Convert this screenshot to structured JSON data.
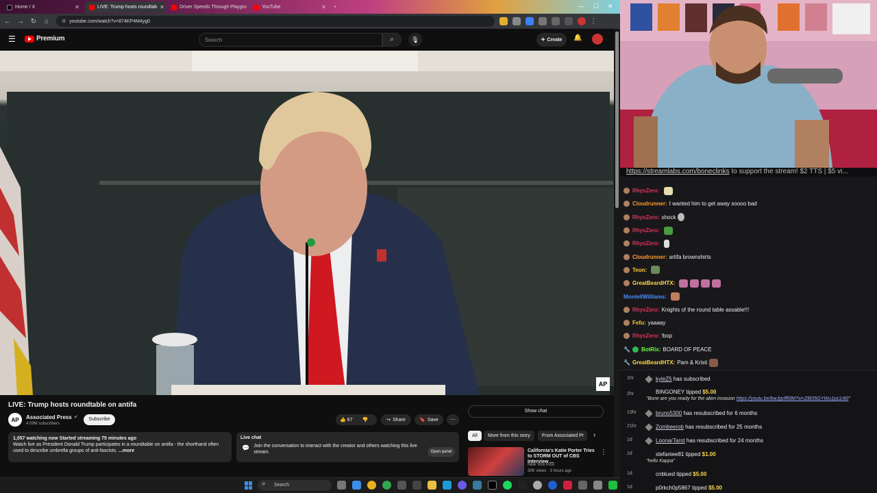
{
  "browser": {
    "tabs": [
      {
        "label": "Home / X",
        "color": "#000000"
      },
      {
        "label": "LIVE: Trump hosts roundtab",
        "color": "#ff0000"
      },
      {
        "label": "Driver Speeds Through Playgro",
        "color": "#ff0000"
      },
      {
        "label": "YouTube",
        "color": "#ff0000"
      }
    ],
    "url": "youtube.com/watch?v=874KP4M4yg0"
  },
  "youtube": {
    "brand": "Premium",
    "search_placeholder": "Search",
    "create_label": "Create",
    "video_title": "LIVE: Trump hosts roundtable on antifa",
    "channel_name": "Associated Press",
    "channel_avatar_text": "AP",
    "subscribers": "4.09M subscribers",
    "subscribe_label": "Subscribe",
    "likes": "67",
    "share_label": "Share",
    "save_label": "Save",
    "show_chat_label": "Show chat",
    "description_stats": "1,057 watching now  Started streaming 75 minutes ago",
    "description_text": "Watch live as President Donald Trump participates in a roundtable on antifa - the shorthand often used to describe umbrella groups of anti-fascists.",
    "more_label": "...more",
    "live_chat_title": "Live chat",
    "live_chat_text": "Join the conversation to interact with the creator and others watching this live stream.",
    "open_panel_label": "Open panel",
    "chips": [
      "All",
      "More from this story",
      "From Associated Pr"
    ],
    "rec": {
      "title": "California's Katie Porter Tries to STORM OUT of CBS Interview ...",
      "channel": "New York Post",
      "meta": "30K views · 3 hours ago"
    },
    "video_watermark": "AP"
  },
  "taskbar": {
    "search_placeholder": "Search"
  },
  "stream": {
    "banner_link": "https://streamlabs.com/boneclinks",
    "banner_text": " to support the stream! $2 TTS | $5 vi..."
  },
  "chat": [
    {
      "user": "RhysZero:",
      "color": "#e8305a",
      "text": "",
      "emotes": 1
    },
    {
      "user": "Cloudrunner:",
      "color": "#ff9c2a",
      "text": "I wanted him to get away soooo bad",
      "emotes": 0
    },
    {
      "user": "RhysZero:",
      "color": "#e8305a",
      "text": "shock",
      "emotes": 1
    },
    {
      "user": "RhysZero:",
      "color": "#e8305a",
      "text": "",
      "emotes": 1
    },
    {
      "user": "RhysZero:",
      "color": "#e8305a",
      "text": "",
      "emotes": 1
    },
    {
      "user": "Cloudrunner:",
      "color": "#ff9c2a",
      "text": "artifa brownshirts",
      "emotes": 0
    },
    {
      "user": "Teon:",
      "color": "#ffcc33",
      "text": "",
      "emotes": 1
    },
    {
      "user": "GreatBeardHTX:",
      "color": "#ffd84a",
      "text": "",
      "emotes": 4
    },
    {
      "user": "MontellWilliams:",
      "color": "#4a8cff",
      "text": "",
      "emotes": 1
    },
    {
      "user": "RhysZero:",
      "color": "#e8305a",
      "text": "Knights of the round table assable!!!",
      "emotes": 0
    },
    {
      "user": "Fefu:",
      "color": "#ffcc33",
      "text": "yaaaay",
      "emotes": 0
    },
    {
      "user": "RhysZero:",
      "color": "#e8305a",
      "text": "!bop",
      "emotes": 0
    },
    {
      "user": "BotRix:",
      "color": "#6cff3a",
      "text": "BOARD OF PEACE",
      "emotes": 0
    },
    {
      "user": "GreatBeardHTX:",
      "color": "#ffd84a",
      "text": "Pam & Kristi",
      "emotes": 1
    }
  ],
  "events": [
    {
      "time": "1hr",
      "user": "kyleZ5",
      "text": " has subscribed"
    },
    {
      "time": "2hr",
      "user": "BINGONEY",
      "text": " tipped ",
      "amount": "$5.00",
      "note": "\"Bone are you ready for the alien invasion ",
      "link": "https://youtu.be/bwJgcflf0lM?si=ZBl35GYWu1ps1r80",
      "note_end": "\""
    },
    {
      "time": "13hr",
      "user": "bruno5300",
      "text": " has resubscribed for 6 months"
    },
    {
      "time": "21hr",
      "user": "Zombeerob",
      "text": " has resubscribed for 25 months"
    },
    {
      "time": "1d",
      "user": "LoonarTarot",
      "text": " has resubscribed for 24 months"
    },
    {
      "time": "1d",
      "user": "stefaniee81",
      "text": " tipped ",
      "amount": "$1.00",
      "note": "\"hello Kappa\""
    },
    {
      "time": "1d",
      "user": "cnblued",
      "text": " tipped ",
      "amount": "$5.00"
    },
    {
      "time": "1d",
      "user": "p0rkch0p5867",
      "text": " tipped ",
      "amount": "$5.00"
    }
  ]
}
